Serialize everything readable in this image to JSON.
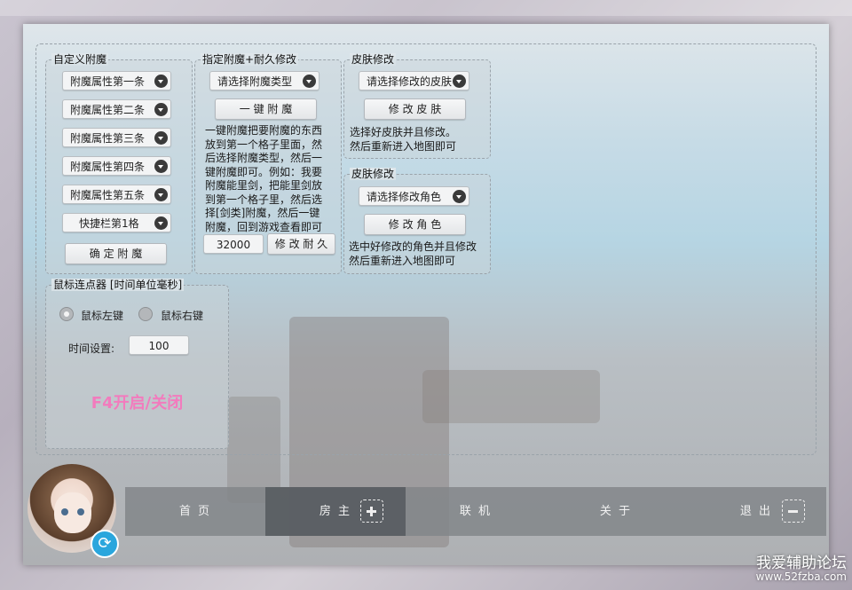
{
  "groups": {
    "custom_enchant": {
      "title": "自定义附魔",
      "combos": [
        "附魔属性第一条",
        "附魔属性第二条",
        "附魔属性第三条",
        "附魔属性第四条",
        "附魔属性第五条",
        "快捷栏第1格"
      ],
      "confirm_button": "确 定 附 魔"
    },
    "enchant_durability": {
      "title": "指定附魔+耐久修改",
      "type_combo": "请选择附魔类型",
      "one_key_button": "一 键 附 魔",
      "description_lines": [
        "一键附魔把要附魔的东西",
        "放到第一个格子里面，然",
        "后选择附魔类型，然后一",
        "键附魔即可。例如：我要",
        "附魔能里剑，把能里剑放",
        "到第一个格子里，然后选",
        "择[剑类]附魔，然后一键",
        "附魔，回到游戏查看即可"
      ],
      "durability_value": "32000",
      "durability_button": "修 改 耐 久"
    },
    "skin": {
      "title": "皮肤修改",
      "combo": "请选择修改的皮肤",
      "button": "修 改 皮 肤",
      "description_lines": [
        "选择好皮肤并且修改。",
        "然后重新进入地图即可"
      ]
    },
    "role": {
      "title": "皮肤修改",
      "combo": "请选择修改角色",
      "button": "修 改 角 色",
      "description_lines": [
        "选中好修改的角色并且修改",
        "然后重新进入地图即可"
      ]
    },
    "clicker": {
      "title": "鼠标连点器 [时间单位毫秒]",
      "radio_left": "鼠标左键",
      "radio_right": "鼠标右键",
      "selected": "left",
      "time_label": "时间设置:",
      "time_value": "100",
      "hotkey_text": "F4开启/关闭",
      "hotkey_color": "#f27bbd"
    }
  },
  "nav": {
    "items": [
      "首 页",
      "房 主",
      "联 机",
      "关 于",
      "退 出"
    ],
    "active_index": 1
  },
  "watermark": {
    "line1": "我爱辅助论坛",
    "line2": "www.52fzba.com"
  },
  "colors": {
    "refresh_button": "#2aa6dd",
    "nav_bar": "#828689"
  }
}
